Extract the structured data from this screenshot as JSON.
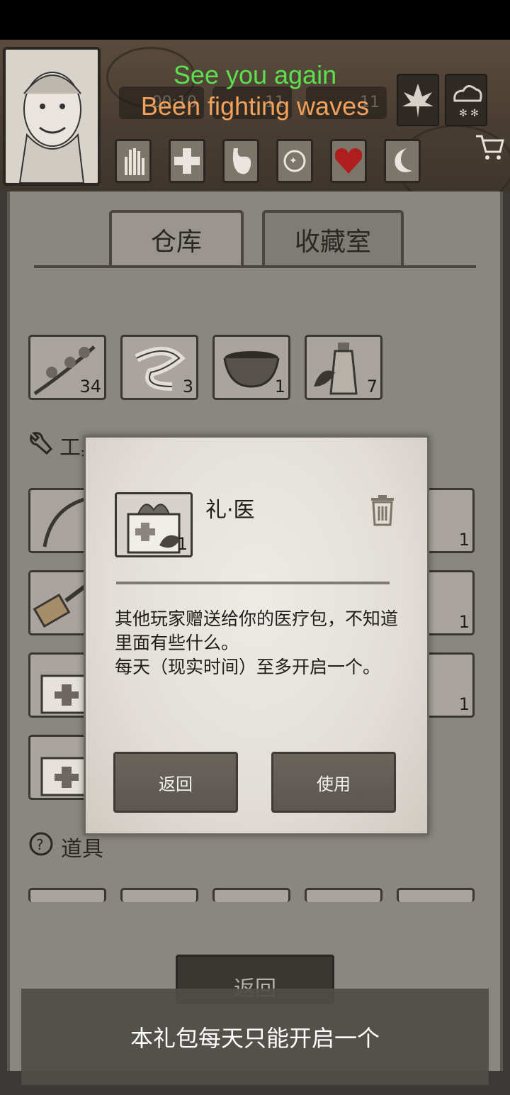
{
  "toast_top": {
    "line1": "See you again",
    "line2": "Been fighting waves"
  },
  "stats": [
    "00:10",
    "11",
    "11"
  ],
  "tabs": {
    "warehouse": "仓库",
    "collection": "收藏室"
  },
  "top_items": [
    {
      "name": "herb-branch-icon",
      "count": "34"
    },
    {
      "name": "bandage-icon",
      "count": "3"
    },
    {
      "name": "bowl-icon",
      "count": "1"
    },
    {
      "name": "bottle-herb-icon",
      "count": "7"
    }
  ],
  "sections": {
    "tools": "工具",
    "props": "道具"
  },
  "right_counts": [
    "1",
    "1",
    "1"
  ],
  "dialog": {
    "icon_count": "1",
    "title": "礼·医",
    "description": "其他玩家赠送给你的医疗包，不知道里面有些什么。\n每天（现实时间）至多开启一个。",
    "back_label": "返回",
    "use_label": "使用"
  },
  "bottom_back_label": "返回",
  "toast_bottom": "本礼包每天只能开启一个"
}
